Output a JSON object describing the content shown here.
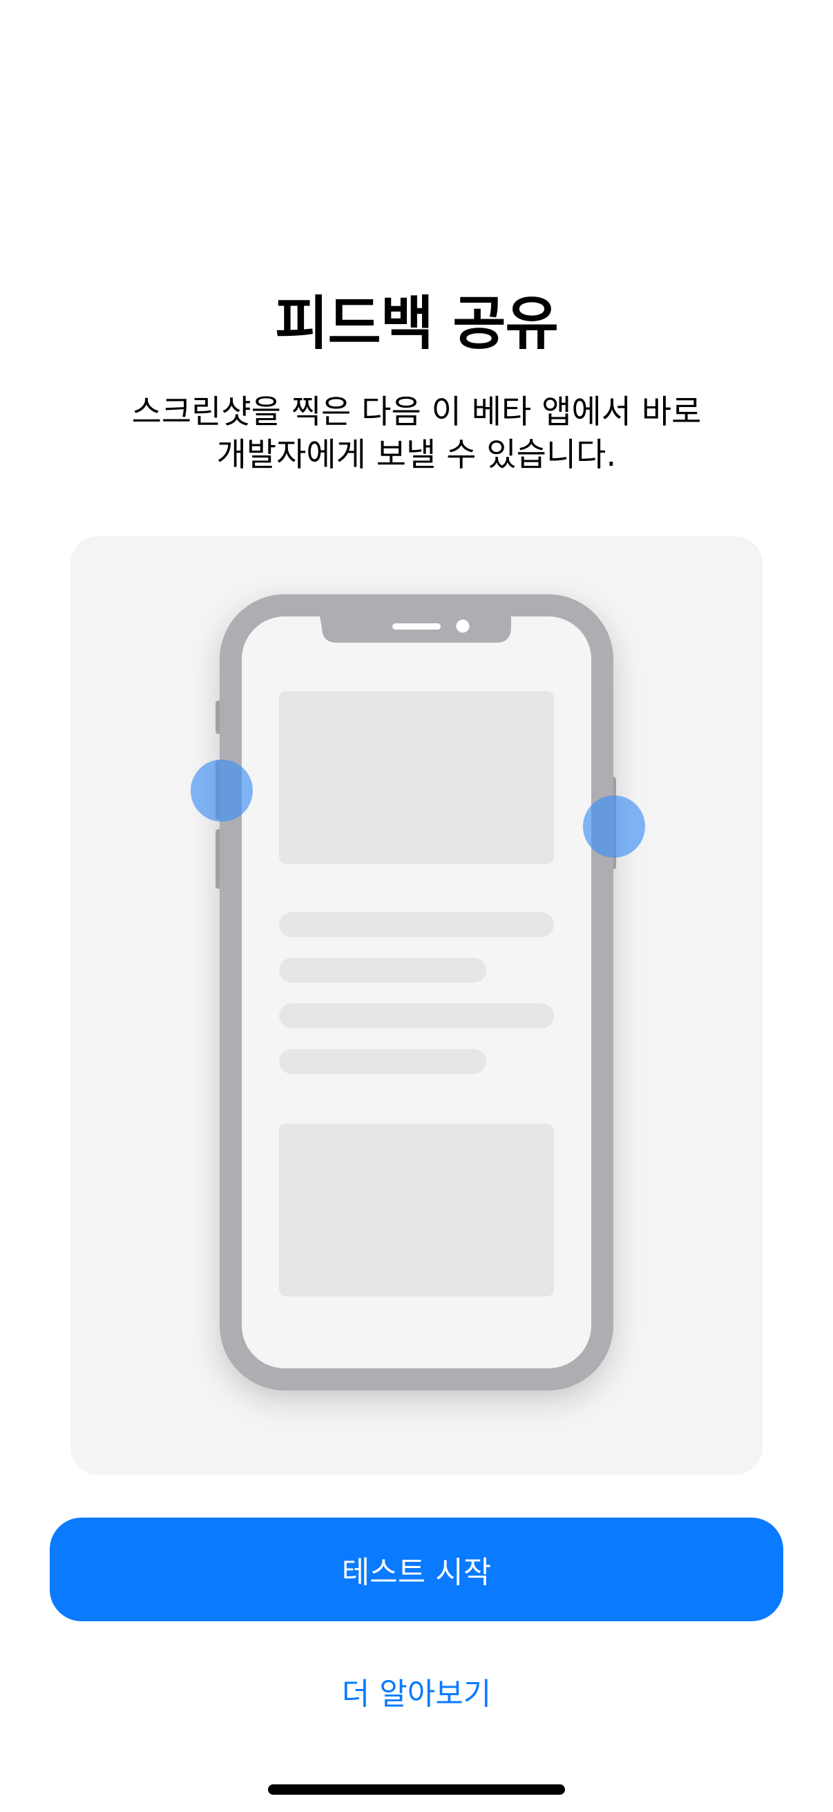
{
  "header": {
    "title": "피드백 공유",
    "subtitle": "스크린샷을 찍은 다음 이 베타 앱에서 바로\n개발자에게 보낼 수 있습니다."
  },
  "illustration": {
    "frame_color": "#aeaeb2",
    "screen_color": "#f5f5f5",
    "placeholder_color": "#e6e6e8",
    "press_indicator_color": "#5aa5f5"
  },
  "actions": {
    "primary_label": "테스트 시작",
    "secondary_label": "더 알아보기"
  },
  "colors": {
    "accent": "#0a7aff",
    "background": "#ffffff",
    "card_background": "#f4f4f5"
  }
}
